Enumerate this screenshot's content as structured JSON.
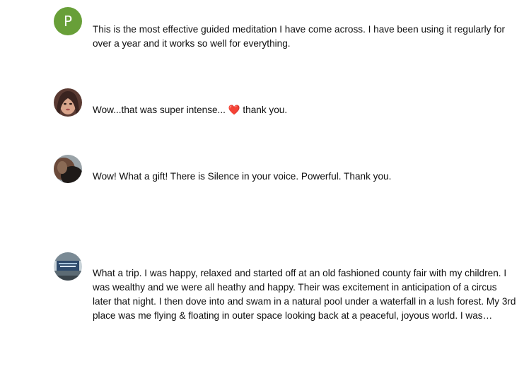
{
  "comments": [
    {
      "avatar_letter": "P",
      "avatar_color": "#689f38",
      "text": "This is the most effective guided meditation I have come across. I  have been using it regularly for over  a year and it works so well for everything."
    },
    {
      "avatar_icon": "user-photo-icon",
      "text_before": "Wow...that was super intense... ",
      "heart": "❤️",
      "text_after": " thank you."
    },
    {
      "avatar_icon": "user-photo-icon",
      "text": "Wow! What a gift! There is Silence in your voice. Powerful. Thank you."
    },
    {
      "avatar_icon": "user-logo-icon",
      "text": "What a trip. I was happy, relaxed and started off at an old fashioned county fair with my children. I was wealthy and we were all heathy and happy. Their was excitement in anticipation of a circus later that night. I then dove into and swam in a natural pool under a waterfall in a lush forest. My 3rd place was me flying & floating in outer space looking back at a peaceful, joyous world. I was…"
    }
  ]
}
